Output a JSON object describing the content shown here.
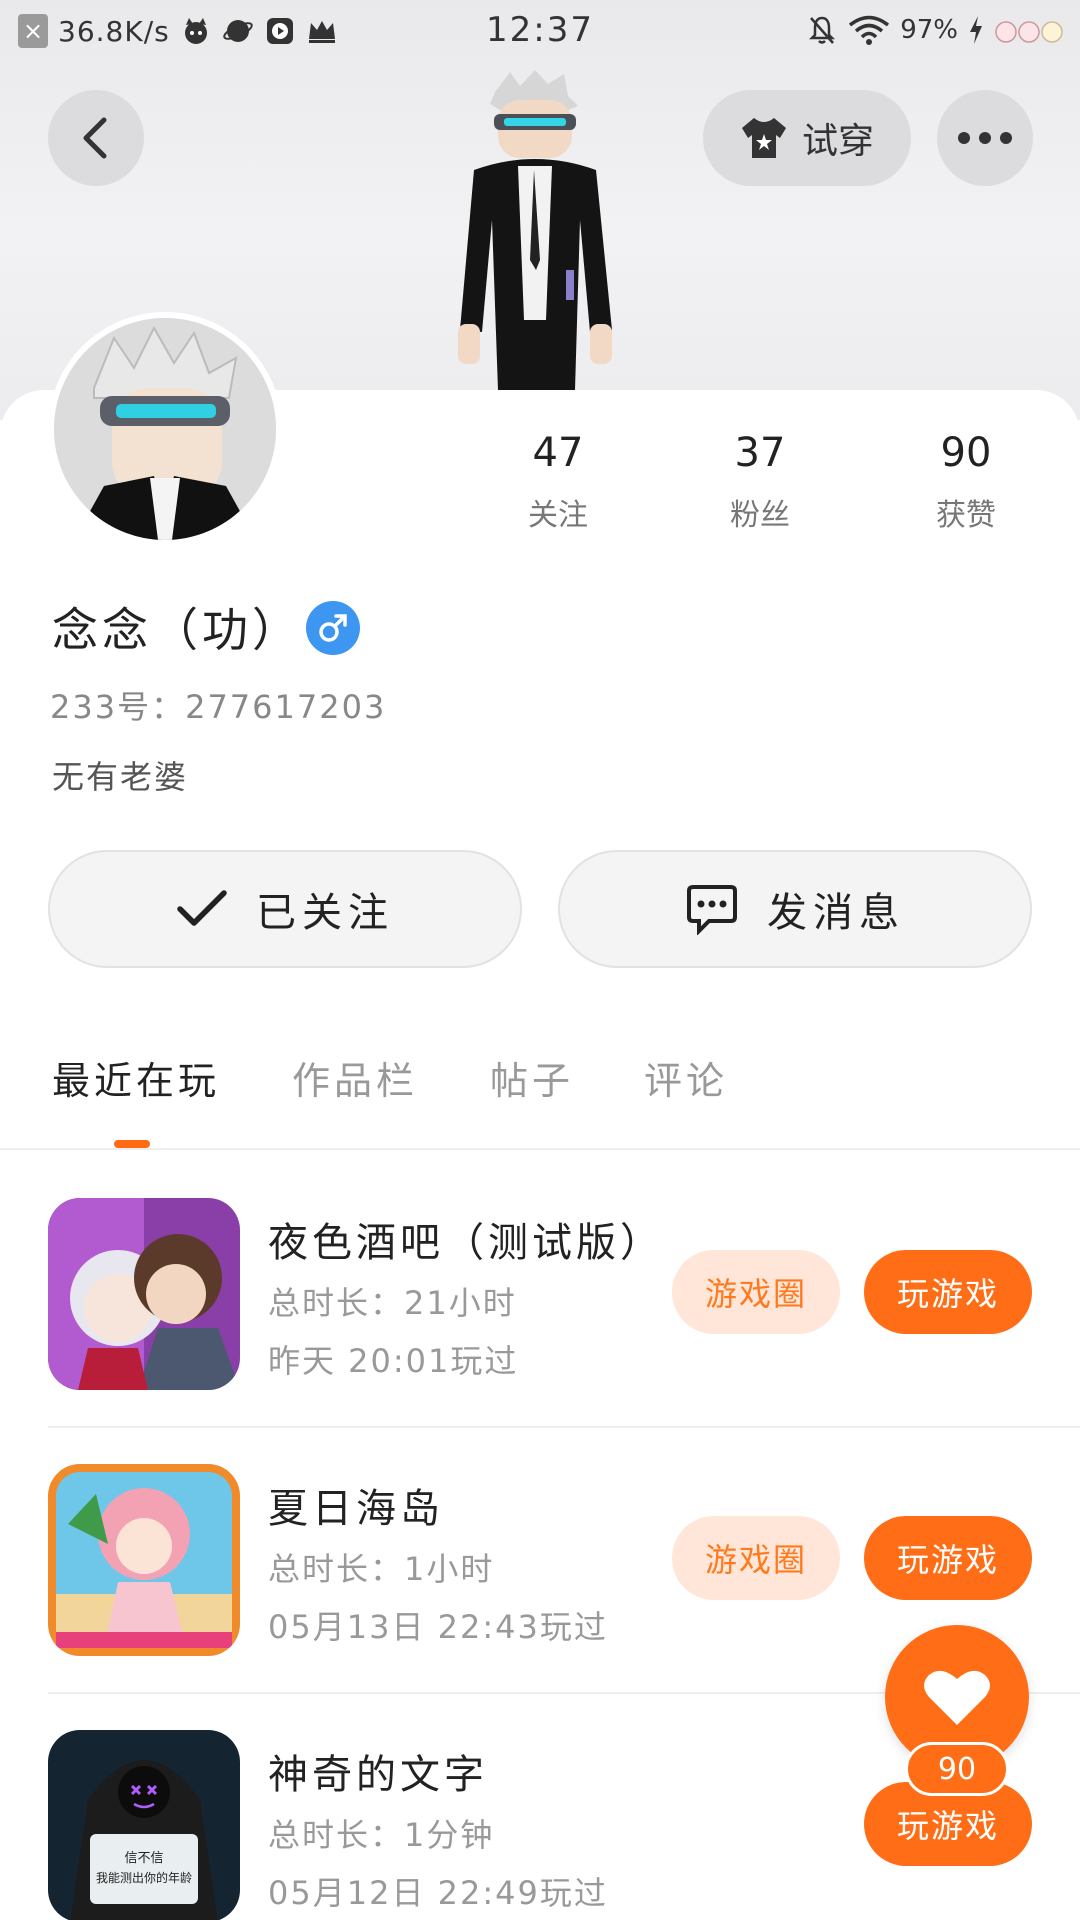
{
  "status_bar": {
    "speed": "36.8K/s",
    "time": "12:37",
    "battery": "97%"
  },
  "header": {
    "try_on_label": "试穿"
  },
  "profile": {
    "name": "念念（功）",
    "uid": "233号：277617203",
    "bio": "无有老婆",
    "stats": [
      {
        "value": "47",
        "label": "关注"
      },
      {
        "value": "37",
        "label": "粉丝"
      },
      {
        "value": "90",
        "label": "获赞"
      }
    ]
  },
  "actions": {
    "followed_label": "已关注",
    "message_label": "发消息"
  },
  "tabs": [
    {
      "label": "最近在玩",
      "active": true
    },
    {
      "label": "作品栏",
      "active": false
    },
    {
      "label": "帖子",
      "active": false
    },
    {
      "label": "评论",
      "active": false
    }
  ],
  "games": [
    {
      "title": "夜色酒吧（测试版）",
      "duration": "总时长：21小时",
      "last_played": "昨天 20:01玩过",
      "circle_label": "游戏圈",
      "play_label": "玩游戏"
    },
    {
      "title": "夏日海岛",
      "duration": "总时长：1小时",
      "last_played": "05月13日 22:43玩过",
      "circle_label": "游戏圈",
      "play_label": "玩游戏"
    },
    {
      "title": "神奇的文字",
      "duration": "总时长：1分钟",
      "last_played": "05月12日 22:49玩过",
      "play_label": "玩游戏",
      "thumb_text": "信不信\n我能测出你的年龄"
    }
  ],
  "like_fab": {
    "count": "90"
  },
  "colors": {
    "accent": "#ff6e16",
    "accent_light": "#ffe6d8",
    "gender_blue": "#3d96f0"
  }
}
